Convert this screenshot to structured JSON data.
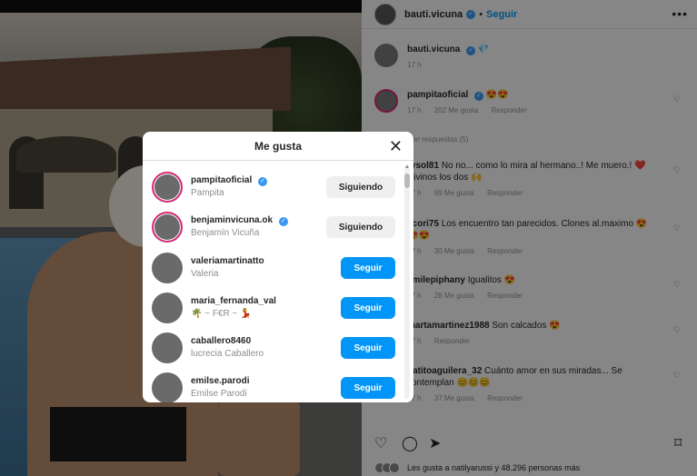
{
  "post": {
    "author": "bauti.vicuna",
    "follow_label": "Seguir",
    "caption_author": "bauti.vicuna",
    "caption_emoji": "💎",
    "caption_time": "17 h",
    "more_label": "•••"
  },
  "comments": [
    {
      "user": "pampitaoficial",
      "verified": true,
      "text": "😍😍",
      "time": "17 h",
      "likes": "202 Me gusta",
      "reply": "Responder"
    },
    {
      "user": "rysol81",
      "text": "No no... como lo mira al hermano..! Me muero.! ❤️ Divinos los dos 🙌",
      "time": "17 h",
      "likes": "69 Me gusta",
      "reply": "Responder"
    },
    {
      "user": "ecori75",
      "text": "Los encuentro tan parecidos. Clones al.maximo 😍😍😍",
      "time": "17 h",
      "likes": "30 Me gusta",
      "reply": "Responder"
    },
    {
      "user": "emilepiphany",
      "text": "Igualitos 😍",
      "time": "17 h",
      "likes": "28 Me gusta",
      "reply": "Responder"
    },
    {
      "user": "martamartinez1988",
      "text": "Son calcados 😍",
      "time": "17 h",
      "likes": "",
      "reply": "Responder"
    },
    {
      "user": "patitoaguilera_32",
      "text": "Cuánto amor en sus miradas... Se contemplan 😊😊😊",
      "time": "17 h",
      "likes": "37 Me gusta",
      "reply": "Responder"
    }
  ],
  "view_replies": "Ver respuestas (5)",
  "likes_summary": "Les gusta a natilyarussi y 48.296 personas más",
  "modal": {
    "title": "Me gusta",
    "close": "✕",
    "users": [
      {
        "username": "pampitaoficial",
        "verified": true,
        "fullname": "Pampita",
        "button": "Siguiendo"
      },
      {
        "username": "benjaminvicuna.ok",
        "verified": true,
        "fullname": "Benjamín Vicuña",
        "button": "Siguiendo"
      },
      {
        "username": "valeriamartinatto",
        "fullname": "Valeria",
        "button": "Seguir"
      },
      {
        "username": "maria_fernanda_val",
        "fullname": "🌴 ~ F€R ~ 💃",
        "button": "Seguir"
      },
      {
        "username": "caballero8460",
        "fullname": "lucrecia Caballero",
        "button": "Seguir"
      },
      {
        "username": "emilse.parodi",
        "fullname": "Emilse Parodi",
        "button": "Seguir"
      }
    ]
  },
  "icons": {
    "heart": "♡",
    "comment": "◯",
    "share": "➤",
    "bookmark": "⌑"
  },
  "colors": {
    "accent": "#0095f6",
    "verified": "#3897f0",
    "ring": "#d62976"
  }
}
